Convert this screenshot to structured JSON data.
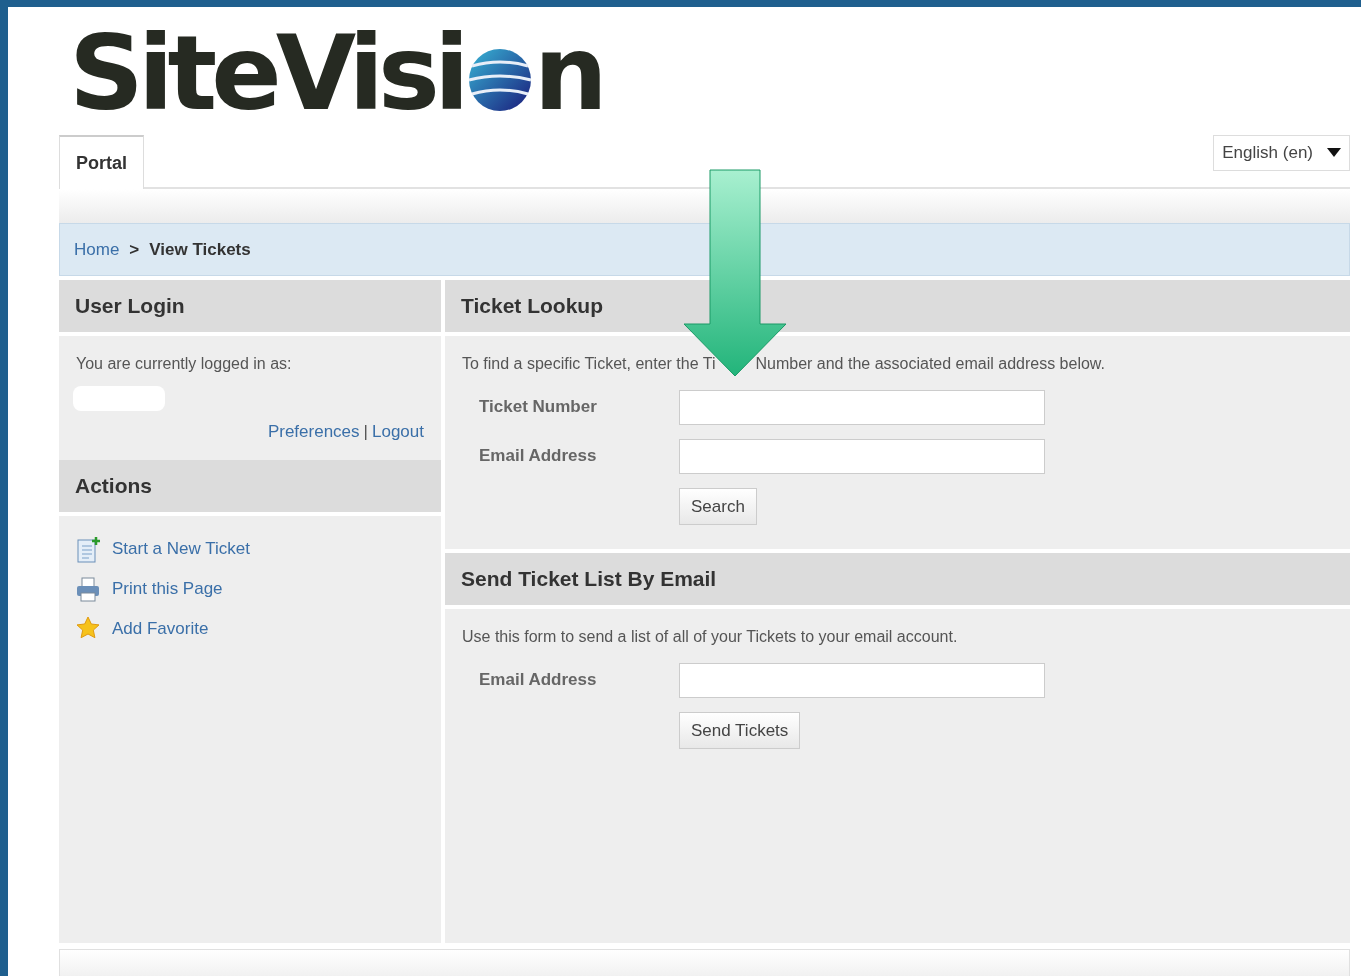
{
  "logo": {
    "before": "SiteVisi",
    "after": "n"
  },
  "tabs": [
    {
      "label": "Portal",
      "selected": true
    }
  ],
  "language": {
    "value": "English (en)"
  },
  "breadcrumb_separator": ">",
  "breadcrumb": [
    {
      "label": "Home",
      "link": true
    },
    {
      "label": "View Tickets",
      "link": false
    }
  ],
  "user_login": {
    "title": "User Login",
    "text": "You are currently logged in as:",
    "links": [
      "Preferences",
      "Logout"
    ],
    "separator": "|"
  },
  "actions": {
    "title": "Actions",
    "items": [
      {
        "kind": "new-ticket",
        "label": "Start a New Ticket"
      },
      {
        "kind": "print",
        "label": "Print this Page"
      },
      {
        "kind": "favorite",
        "label": "Add Favorite"
      }
    ]
  },
  "ticket_lookup": {
    "title": "Ticket Lookup",
    "intro_before": "To find a specific Ticket, enter the Ti",
    "intro_after": "Number and the associated email address below.",
    "fields": [
      {
        "label": "Ticket Number"
      },
      {
        "label": "Email Address"
      }
    ],
    "button": "Search"
  },
  "send_list": {
    "title": "Send Ticket List By Email",
    "intro": "Use this form to send a list of all of your Tickets to your email account.",
    "fields": [
      {
        "label": "Email Address"
      }
    ],
    "button": "Send Tickets"
  }
}
